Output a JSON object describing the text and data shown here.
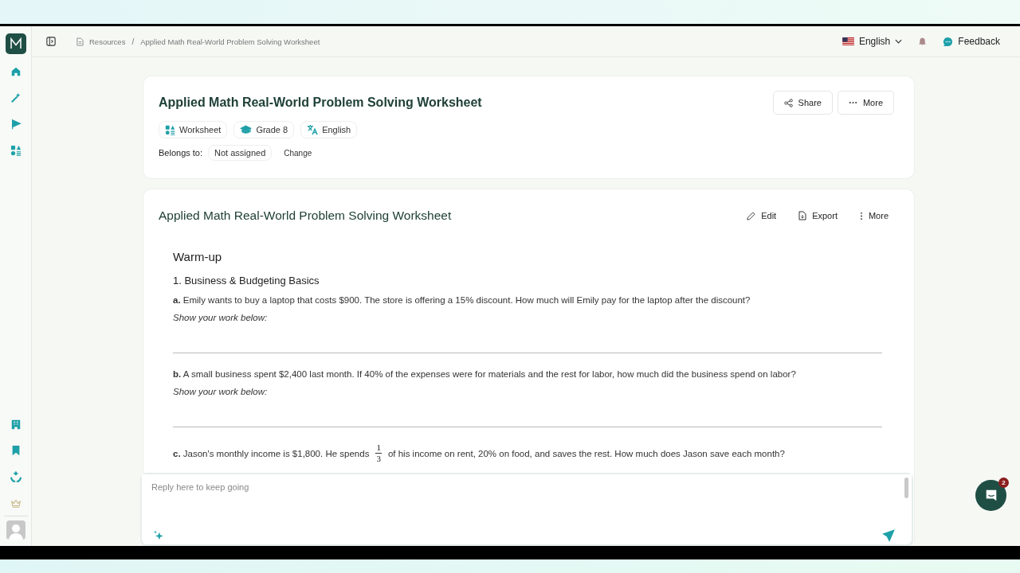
{
  "breadcrumb": [
    {
      "label": "Resources"
    },
    {
      "label": "Applied Math Real-World Problem Solving Worksheet"
    }
  ],
  "breadcrumb_separator": "/",
  "language": "English",
  "feedback": "Feedback",
  "header": {
    "title": "Applied Math Real-World Problem Solving Worksheet",
    "actions": [
      {
        "kind": "share",
        "label": "Share"
      },
      {
        "kind": "more",
        "label": "More"
      }
    ],
    "tags": [
      {
        "kind": "type",
        "label": "Worksheet"
      },
      {
        "kind": "grade",
        "label": "Grade 8"
      },
      {
        "kind": "language",
        "label": "English"
      }
    ],
    "belongs_label": "Belongs to:",
    "belongs_value": "Not assigned",
    "change": "Change"
  },
  "document": {
    "title": "Applied Math Real-World Problem Solving Worksheet",
    "actions": [
      {
        "kind": "edit",
        "label": "Edit"
      },
      {
        "kind": "export",
        "label": "Export"
      },
      {
        "kind": "more",
        "label": "More"
      }
    ],
    "section": "Warm-up",
    "heading": "1. Business & Budgeting Basics",
    "questions": [
      {
        "kind": "work",
        "text": "**a.** Emily wants to buy a laptop that costs $900. The store is offering a 15% discount. How much will Emily pay for the laptop after the discount?",
        "prompt": "Show your work below:"
      },
      {
        "kind": "work",
        "text": "**b.** A small business spent $2,400 last month. If 40% of the expenses were for materials and the rest for labor, how much did the business spend on labor?",
        "prompt": "Show your work below:"
      },
      {
        "kind": "fraction",
        "text": "**c.** Jason's monthly income is $1,800. He spends",
        "numerator": "1",
        "denominator": "3",
        "text_after": "of his income on rent, 20% on food, and saves the rest. How much does Jason save each month?"
      }
    ]
  },
  "reply": {
    "placeholder": "Reply here to keep going"
  },
  "chat_badge": "2"
}
